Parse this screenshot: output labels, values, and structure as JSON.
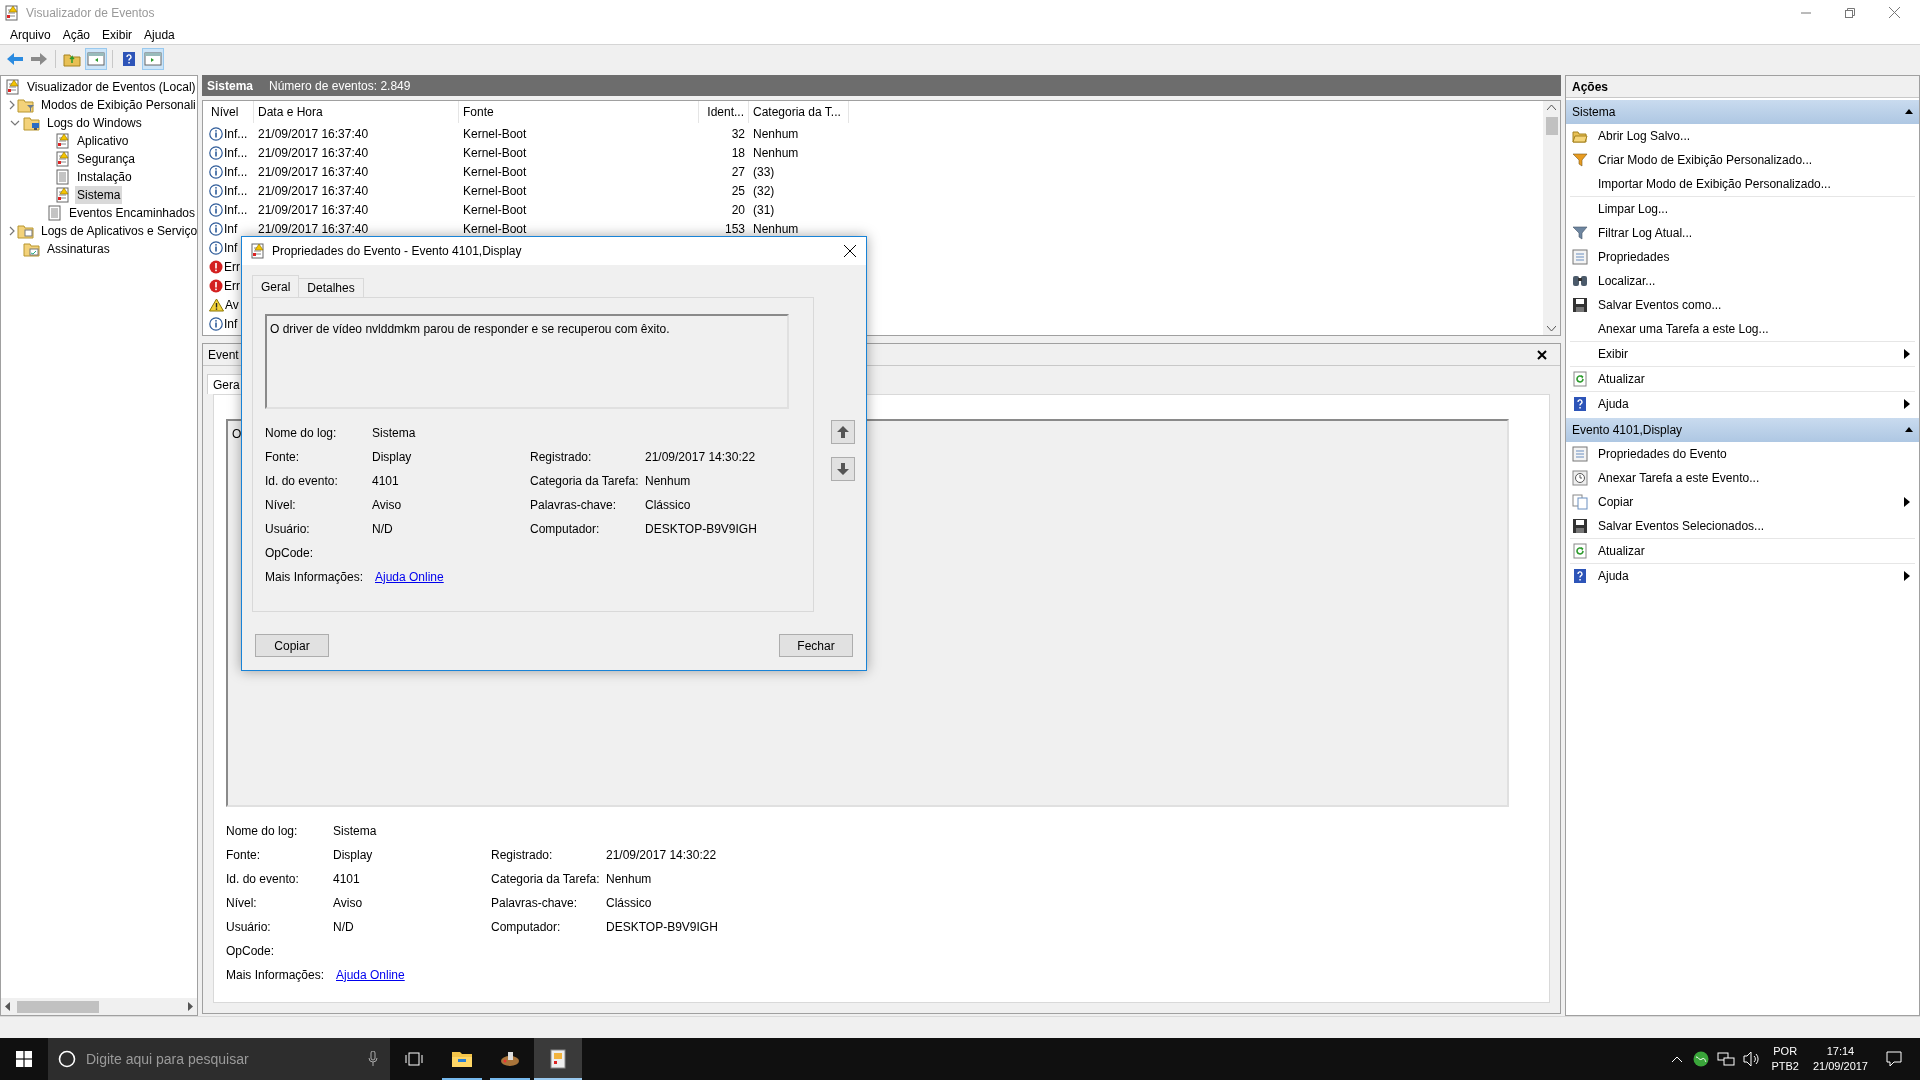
{
  "window": {
    "title": "Visualizador de Eventos"
  },
  "menu": [
    "Arquivo",
    "Ação",
    "Exibir",
    "Ajuda"
  ],
  "toolbar": [
    {
      "pressed": false
    },
    {
      "pressed": false
    },
    {
      "pressed": false
    },
    {
      "pressed": true
    },
    {
      "pressed": false
    },
    {
      "pressed": true
    }
  ],
  "tree": [
    {
      "label": "Visualizador de Eventos (Local)",
      "selected": false,
      "kind": "root",
      "children": [
        {
          "label": "Modos de Exibição Personali",
          "selected": false,
          "kind": "views",
          "expanded": false
        },
        {
          "label": "Logs do Windows",
          "selected": false,
          "kind": "computer",
          "expanded": true,
          "children": [
            {
              "label": "Aplicativo",
              "selected": false,
              "kind": "log"
            },
            {
              "label": "Segurança",
              "selected": false,
              "kind": "log"
            },
            {
              "label": "Instalação",
              "selected": false,
              "kind": "plain"
            },
            {
              "label": "Sistema",
              "selected": true,
              "kind": "log"
            },
            {
              "label": "Eventos Encaminhados",
              "selected": false,
              "kind": "plain"
            }
          ]
        },
        {
          "label": "Logs de Aplicativos e Serviço",
          "selected": false,
          "kind": "folder",
          "expanded": false
        },
        {
          "label": "Assinaturas",
          "selected": false,
          "kind": "subs"
        }
      ]
    }
  ],
  "events": {
    "title": "Sistema",
    "count": "Número de eventos: 2.849",
    "columns": [
      "Nível",
      "Data e Hora",
      "Fonte",
      "Ident...",
      "Categoria da T..."
    ],
    "rows": [
      {
        "kind": "info",
        "level": "Inf...",
        "date": "21/09/2017 16:37:40",
        "source": "Kernel-Boot",
        "id": "32",
        "category": "Nenhum"
      },
      {
        "kind": "info",
        "level": "Inf...",
        "date": "21/09/2017 16:37:40",
        "source": "Kernel-Boot",
        "id": "18",
        "category": "Nenhum"
      },
      {
        "kind": "info",
        "level": "Inf...",
        "date": "21/09/2017 16:37:40",
        "source": "Kernel-Boot",
        "id": "27",
        "category": "(33)"
      },
      {
        "kind": "info",
        "level": "Inf...",
        "date": "21/09/2017 16:37:40",
        "source": "Kernel-Boot",
        "id": "25",
        "category": "(32)"
      },
      {
        "kind": "info",
        "level": "Inf...",
        "date": "21/09/2017 16:37:40",
        "source": "Kernel-Boot",
        "id": "20",
        "category": "(31)"
      },
      {
        "kind": "info",
        "level": "Inf",
        "date": "21/09/2017 16:37:40",
        "source": "Kernel-Boot",
        "id": "153",
        "category": "Nenhum"
      },
      {
        "kind": "info",
        "level": "Inf"
      },
      {
        "kind": "error",
        "level": "Err"
      },
      {
        "kind": "error",
        "level": "Err"
      },
      {
        "kind": "warning",
        "level": "Av"
      },
      {
        "kind": "info",
        "level": "Inf"
      }
    ]
  },
  "detail_pane": {
    "title": "Event",
    "tab": "Gera",
    "message": "O",
    "rows": [
      {
        "left": {
          "label": "Nome do log:",
          "value": "Sistema"
        }
      },
      {
        "left": {
          "label": "Fonte:",
          "value": "Display"
        },
        "right": {
          "label": "Registrado:",
          "value": "21/09/2017 14:30:22"
        }
      },
      {
        "left": {
          "label": "Id. do evento:",
          "value": "4101"
        },
        "right": {
          "label": "Categoria da Tarefa:",
          "value": "Nenhum"
        }
      },
      {
        "left": {
          "label": "Nível:",
          "value": "Aviso"
        },
        "right": {
          "label": "Palavras-chave:",
          "value": "Clássico"
        }
      },
      {
        "left": {
          "label": "Usuário:",
          "value": "N/D"
        },
        "right": {
          "label": "Computador:",
          "value": "DESKTOP-B9V9IGH"
        }
      },
      {
        "left": {
          "label": "OpCode:"
        }
      }
    ],
    "more_info": {
      "label": "Mais Informações:",
      "link": "Ajuda Online"
    }
  },
  "actions": {
    "title": "Ações",
    "sections": [
      {
        "title": "Sistema",
        "expanded": true,
        "groups": [
          [
            {
              "label": "Abrir Log Salvo...",
              "submenu": false
            },
            {
              "label": "Criar Modo de Exibição Personalizado...",
              "submenu": false
            },
            {
              "label": "Importar Modo de Exibição Personalizado...",
              "submenu": false
            }
          ],
          [
            {
              "label": "Limpar Log...",
              "submenu": false
            },
            {
              "label": "Filtrar Log Atual...",
              "submenu": false
            },
            {
              "label": "Propriedades",
              "submenu": false
            },
            {
              "label": "Localizar...",
              "submenu": false
            },
            {
              "label": "Salvar Eventos como...",
              "submenu": false
            },
            {
              "label": "Anexar uma Tarefa a este Log...",
              "submenu": false
            }
          ],
          [
            {
              "label": "Exibir",
              "submenu": true
            }
          ],
          [
            {
              "label": "Atualizar",
              "submenu": false
            }
          ],
          [
            {
              "label": "Ajuda",
              "submenu": true
            }
          ]
        ]
      },
      {
        "title": "Evento 4101,Display",
        "expanded": true,
        "groups": [
          [
            {
              "label": "Propriedades do Evento",
              "submenu": false
            },
            {
              "label": "Anexar Tarefa a este Evento...",
              "submenu": false
            },
            {
              "label": "Copiar",
              "submenu": true
            },
            {
              "label": "Salvar Eventos Selecionados...",
              "submenu": false
            }
          ],
          [
            {
              "label": "Atualizar",
              "submenu": false
            }
          ],
          [
            {
              "label": "Ajuda",
              "submenu": true
            }
          ]
        ]
      }
    ]
  },
  "dialog": {
    "title": "Propriedades do Evento - Evento 4101,Display",
    "tabs": [
      {
        "label": "Geral",
        "selected": true
      },
      {
        "label": "Detalhes",
        "selected": false
      }
    ],
    "message": "O driver de vídeo nvlddmkm parou de responder e se recuperou com êxito.",
    "rows": [
      {
        "left": {
          "label": "Nome do log:",
          "value": "Sistema"
        }
      },
      {
        "left": {
          "label": "Fonte:",
          "value": "Display"
        },
        "right": {
          "label": "Registrado:",
          "value": "21/09/2017 14:30:22"
        }
      },
      {
        "left": {
          "label": "Id. do evento:",
          "value": "4101"
        },
        "right": {
          "label": "Categoria da Tarefa:",
          "value": "Nenhum"
        }
      },
      {
        "left": {
          "label": "Nível:",
          "value": "Aviso"
        },
        "right": {
          "label": "Palavras-chave:",
          "value": "Clássico"
        }
      },
      {
        "left": {
          "label": "Usuário:",
          "value": "N/D"
        },
        "right": {
          "label": "Computador:",
          "value": "DESKTOP-B9V9IGH"
        }
      },
      {
        "left": {
          "label": "OpCode:"
        }
      }
    ],
    "more_info": {
      "label": "Mais Informações:",
      "link": "Ajuda Online"
    },
    "buttons": [
      "Copiar",
      "Fechar"
    ]
  },
  "taskbar": {
    "search": {
      "placeholder": "Digite aqui para pesquisar"
    },
    "apps": [
      {
        "running": true,
        "active": false
      },
      {
        "running": true,
        "active": false
      },
      {
        "running": true,
        "active": true
      }
    ],
    "language": "POR",
    "layout": "PTB2",
    "time": "17:14",
    "date": "21/09/2017"
  }
}
